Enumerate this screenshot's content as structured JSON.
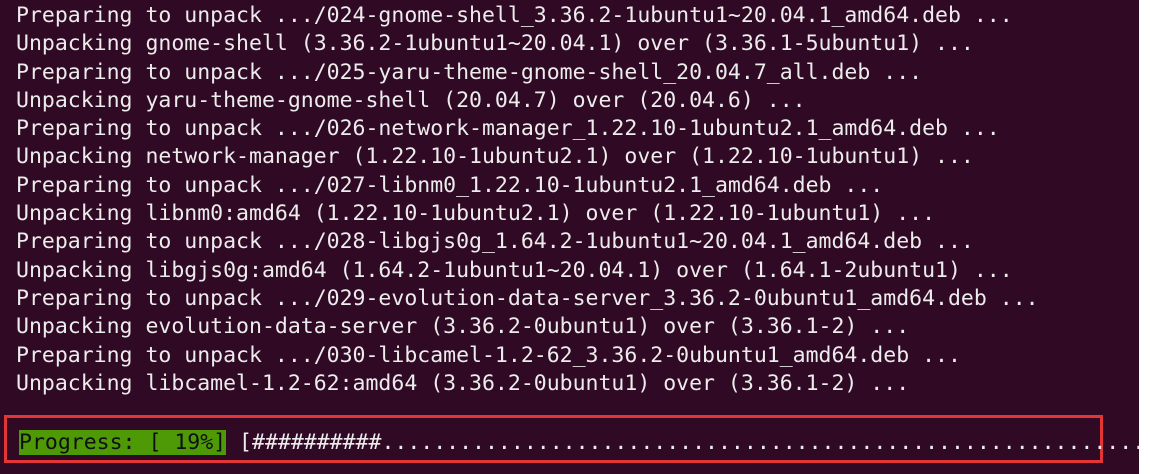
{
  "terminal": {
    "lines": [
      "Preparing to unpack .../024-gnome-shell_3.36.2-1ubuntu1~20.04.1_amd64.deb ...",
      "Unpacking gnome-shell (3.36.2-1ubuntu1~20.04.1) over (3.36.1-5ubuntu1) ...",
      "Preparing to unpack .../025-yaru-theme-gnome-shell_20.04.7_all.deb ...",
      "Unpacking yaru-theme-gnome-shell (20.04.7) over (20.04.6) ...",
      "Preparing to unpack .../026-network-manager_1.22.10-1ubuntu2.1_amd64.deb ...",
      "Unpacking network-manager (1.22.10-1ubuntu2.1) over (1.22.10-1ubuntu1) ...",
      "Preparing to unpack .../027-libnm0_1.22.10-1ubuntu2.1_amd64.deb ...",
      "Unpacking libnm0:amd64 (1.22.10-1ubuntu2.1) over (1.22.10-1ubuntu1) ...",
      "Preparing to unpack .../028-libgjs0g_1.64.2-1ubuntu1~20.04.1_amd64.deb ...",
      "Unpacking libgjs0g:amd64 (1.64.2-1ubuntu1~20.04.1) over (1.64.1-2ubuntu1) ...",
      "Preparing to unpack .../029-evolution-data-server_3.36.2-0ubuntu1_amd64.deb ...",
      "Unpacking evolution-data-server (3.36.2-0ubuntu1) over (3.36.1-2) ...",
      "Preparing to unpack .../030-libcamel-1.2-62_3.36.2-0ubuntu1_amd64.deb ...",
      "Unpacking libcamel-1.2-62:amd64 (3.36.2-0ubuntu1) over (3.36.1-2) ..."
    ],
    "progress": {
      "label": "Progress: [ 19%]",
      "bar": " [##########.............................................................]",
      "percent": 19
    },
    "colors": {
      "background": "#300a24",
      "text": "#ececec",
      "progress_label_bg": "#4e9a06",
      "highlight_border": "#e33535"
    }
  }
}
